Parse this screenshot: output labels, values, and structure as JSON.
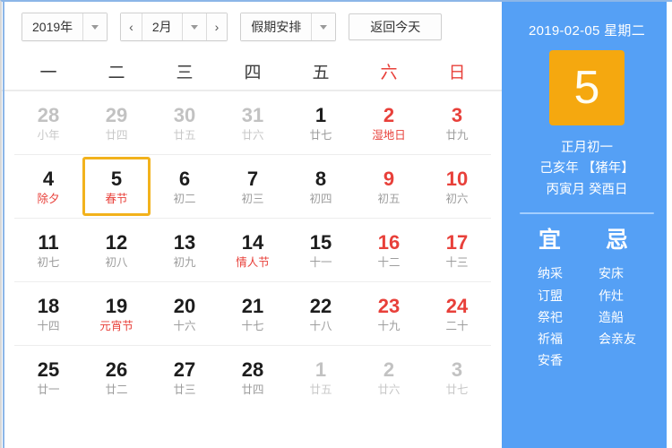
{
  "toolbar": {
    "year_label": "2019年",
    "year_caret": "caret-down-icon",
    "prev_arrow": "‹",
    "month_label": "2月",
    "month_caret": "caret-down-icon",
    "next_arrow": "›",
    "holiday_label": "假期安排",
    "holiday_caret": "caret-down-icon",
    "today_label": "返回今天"
  },
  "weekdays": [
    {
      "label": "一",
      "weekend": false
    },
    {
      "label": "二",
      "weekend": false
    },
    {
      "label": "三",
      "weekend": false
    },
    {
      "label": "四",
      "weekend": false
    },
    {
      "label": "五",
      "weekend": false
    },
    {
      "label": "六",
      "weekend": true
    },
    {
      "label": "日",
      "weekend": true
    }
  ],
  "weeks": [
    [
      {
        "num": "28",
        "sub": "小年",
        "state": "muted"
      },
      {
        "num": "29",
        "sub": "廿四",
        "state": "muted"
      },
      {
        "num": "30",
        "sub": "廿五",
        "state": "muted"
      },
      {
        "num": "31",
        "sub": "廿六",
        "state": "muted"
      },
      {
        "num": "1",
        "sub": "廿七",
        "state": "normal"
      },
      {
        "num": "2",
        "sub": "湿地日",
        "state": "red",
        "sub_red": true
      },
      {
        "num": "3",
        "sub": "廿九",
        "state": "red"
      }
    ],
    [
      {
        "num": "4",
        "sub": "除夕",
        "state": "normal",
        "sub_red": true
      },
      {
        "num": "5",
        "sub": "春节",
        "state": "normal",
        "sub_red": true,
        "selected": true
      },
      {
        "num": "6",
        "sub": "初二",
        "state": "normal"
      },
      {
        "num": "7",
        "sub": "初三",
        "state": "normal"
      },
      {
        "num": "8",
        "sub": "初四",
        "state": "normal"
      },
      {
        "num": "9",
        "sub": "初五",
        "state": "red"
      },
      {
        "num": "10",
        "sub": "初六",
        "state": "red"
      }
    ],
    [
      {
        "num": "11",
        "sub": "初七",
        "state": "normal"
      },
      {
        "num": "12",
        "sub": "初八",
        "state": "normal"
      },
      {
        "num": "13",
        "sub": "初九",
        "state": "normal"
      },
      {
        "num": "14",
        "sub": "情人节",
        "state": "normal",
        "sub_red": true
      },
      {
        "num": "15",
        "sub": "十一",
        "state": "normal"
      },
      {
        "num": "16",
        "sub": "十二",
        "state": "red"
      },
      {
        "num": "17",
        "sub": "十三",
        "state": "red"
      }
    ],
    [
      {
        "num": "18",
        "sub": "十四",
        "state": "normal"
      },
      {
        "num": "19",
        "sub": "元宵节",
        "state": "normal",
        "sub_red": true
      },
      {
        "num": "20",
        "sub": "十六",
        "state": "normal"
      },
      {
        "num": "21",
        "sub": "十七",
        "state": "normal"
      },
      {
        "num": "22",
        "sub": "十八",
        "state": "normal"
      },
      {
        "num": "23",
        "sub": "十九",
        "state": "red"
      },
      {
        "num": "24",
        "sub": "二十",
        "state": "red"
      }
    ],
    [
      {
        "num": "25",
        "sub": "廿一",
        "state": "normal"
      },
      {
        "num": "26",
        "sub": "廿二",
        "state": "normal"
      },
      {
        "num": "27",
        "sub": "廿三",
        "state": "normal"
      },
      {
        "num": "28",
        "sub": "廿四",
        "state": "normal"
      },
      {
        "num": "1",
        "sub": "廿五",
        "state": "muted"
      },
      {
        "num": "2",
        "sub": "廿六",
        "state": "muted"
      },
      {
        "num": "3",
        "sub": "廿七",
        "state": "muted"
      }
    ]
  ],
  "info": {
    "date_line": "2019-02-05 星期二",
    "big_day": "5",
    "lunar_day": "正月初一",
    "lunar_year": "己亥年 【猪年】",
    "lunar_ganzhi": "丙寅月 癸酉日",
    "yi_title": "宜",
    "ji_title": "忌",
    "yi_items": [
      "纳采",
      "订盟",
      "祭祀",
      "祈福",
      "安香"
    ],
    "ji_items": [
      "安床",
      "作灶",
      "造船",
      "会亲友"
    ]
  },
  "colors": {
    "panel_blue": "#55a0f5",
    "accent_orange": "#f5a80f",
    "selected_border": "#f2b21c",
    "weekend_red": "#e8403a",
    "muted_gray": "#c2c2c2"
  }
}
